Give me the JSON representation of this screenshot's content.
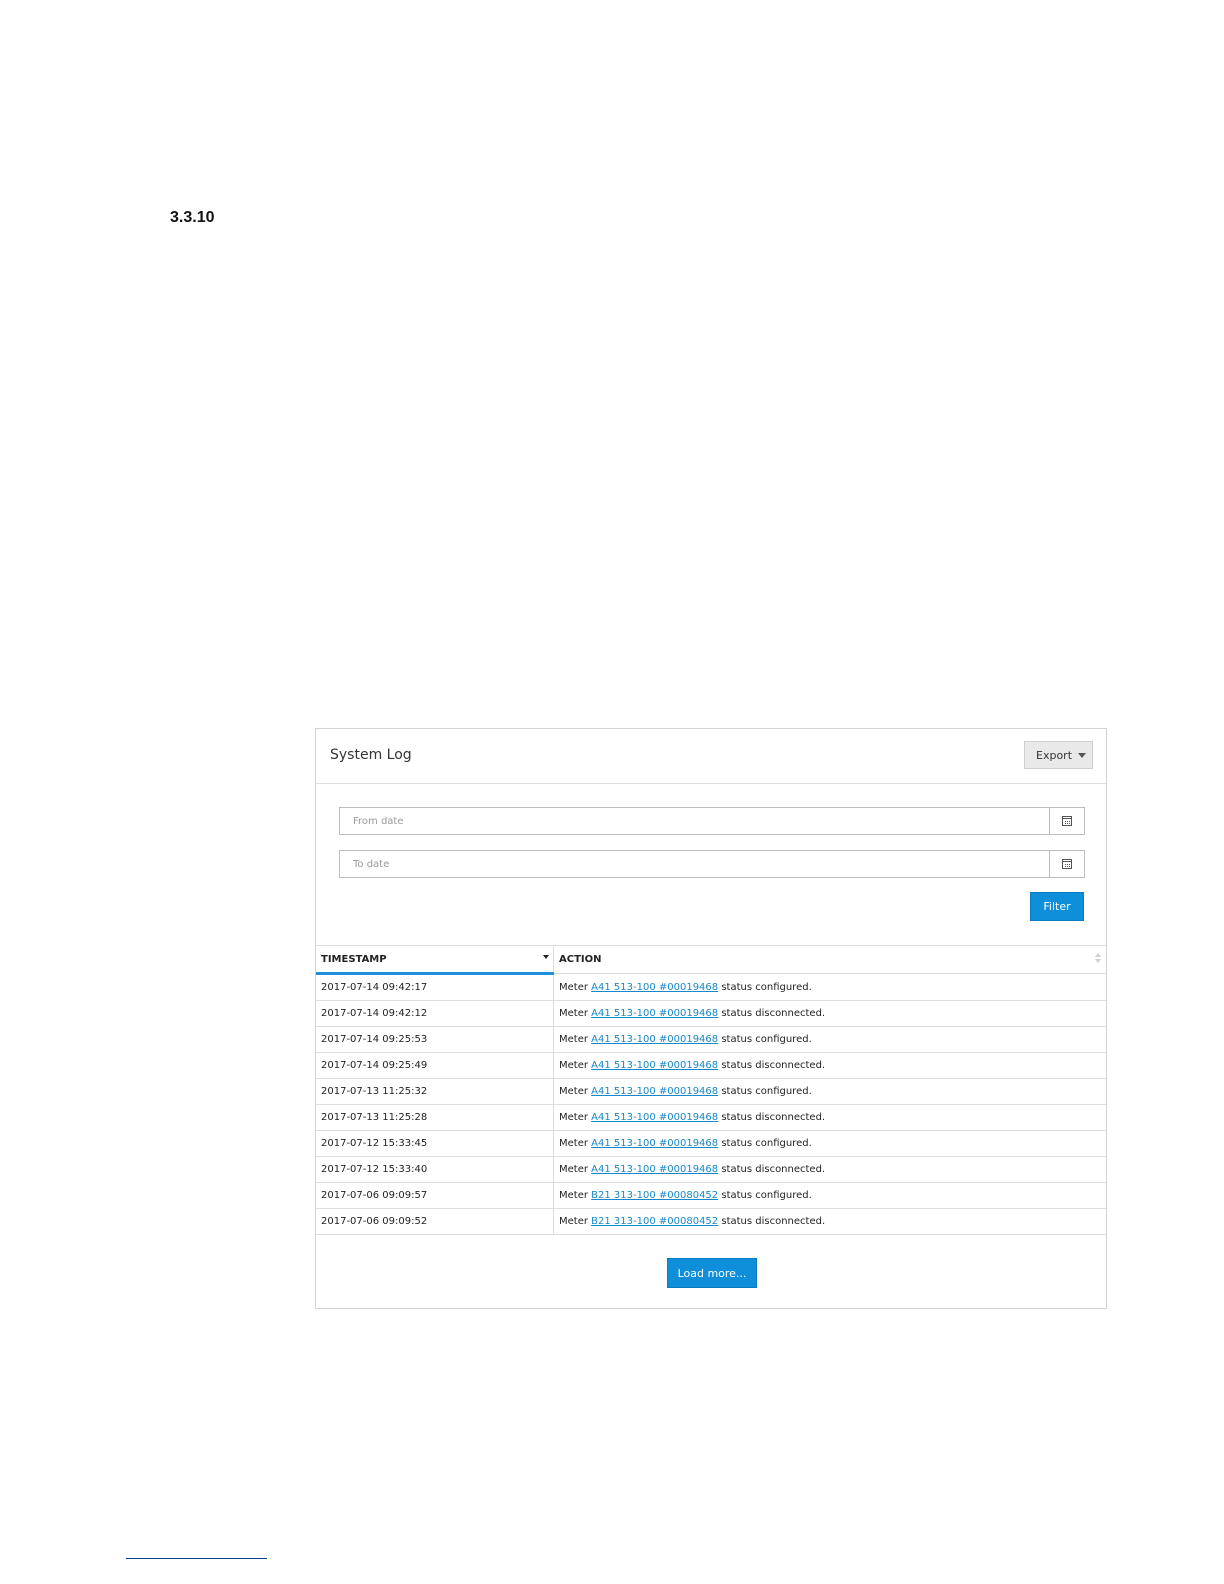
{
  "section": {
    "number": "3.3.10"
  },
  "panel": {
    "title": "System Log",
    "export_label": "Export",
    "from_date_placeholder": "From date",
    "to_date_placeholder": "To date",
    "filter_label": "Filter",
    "load_more_label": "Load more..."
  },
  "table": {
    "columns": [
      "TIMESTAMP",
      "ACTION"
    ],
    "sorted_column": "TIMESTAMP",
    "rows": [
      {
        "timestamp": "2017-07-14 09:42:17",
        "prefix": "Meter",
        "meter": "A41 513-100 #00019468",
        "status": "status configured."
      },
      {
        "timestamp": "2017-07-14 09:42:12",
        "prefix": "Meter",
        "meter": "A41 513-100 #00019468",
        "status": "status disconnected."
      },
      {
        "timestamp": "2017-07-14 09:25:53",
        "prefix": "Meter",
        "meter": "A41 513-100 #00019468",
        "status": "status configured."
      },
      {
        "timestamp": "2017-07-14 09:25:49",
        "prefix": "Meter",
        "meter": "A41 513-100 #00019468",
        "status": "status disconnected."
      },
      {
        "timestamp": "2017-07-13 11:25:32",
        "prefix": "Meter",
        "meter": "A41 513-100 #00019468",
        "status": "status configured."
      },
      {
        "timestamp": "2017-07-13 11:25:28",
        "prefix": "Meter",
        "meter": "A41 513-100 #00019468",
        "status": "status disconnected."
      },
      {
        "timestamp": "2017-07-12 15:33:45",
        "prefix": "Meter",
        "meter": "A41 513-100 #00019468",
        "status": "status configured."
      },
      {
        "timestamp": "2017-07-12 15:33:40",
        "prefix": "Meter",
        "meter": "A41 513-100 #00019468",
        "status": "status disconnected."
      },
      {
        "timestamp": "2017-07-06 09:09:57",
        "prefix": "Meter",
        "meter": "B21 313-100 #00080452",
        "status": "status configured."
      },
      {
        "timestamp": "2017-07-06 09:09:52",
        "prefix": "Meter",
        "meter": "B21 313-100 #00080452",
        "status": "status disconnected."
      }
    ]
  },
  "colors": {
    "accent": "#0f8fd9",
    "link": "#1a87c8",
    "sort_indicator": "#1f8fdb"
  },
  "icons": [
    "calendar-icon",
    "caret-down-icon",
    "sort-desc-icon",
    "sort-icon"
  ]
}
